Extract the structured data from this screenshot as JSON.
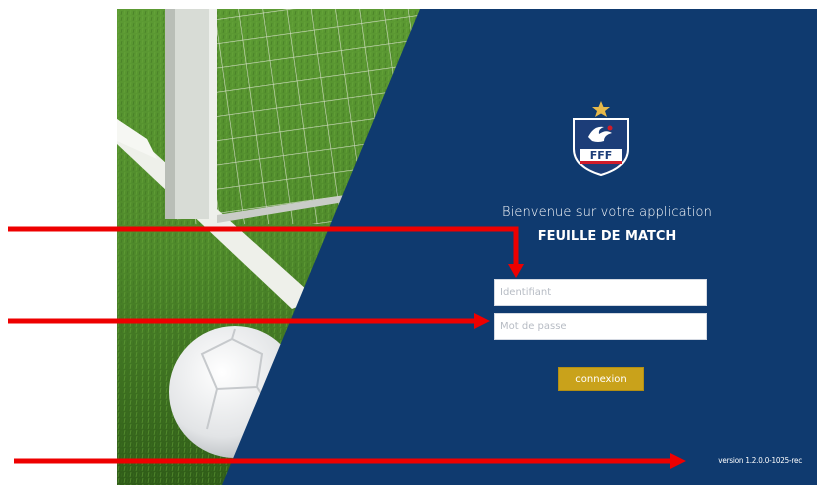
{
  "login": {
    "welcome_text": "Bienvenue sur votre application",
    "app_name": "FEUILLE DE MATCH",
    "username_placeholder": "Identifiant",
    "password_placeholder": "Mot de passe",
    "submit_label": "connexion",
    "version": "version 1.2.0.0-1025-rec"
  },
  "brand": {
    "logo_letters": "FFF"
  },
  "colors": {
    "panel_blue": "#0f3a6f",
    "button_gold": "#c9a21b",
    "annotation_red": "#ee0000",
    "grass_green": "#4f8a2b"
  },
  "annotations": [
    "arrow-to-username",
    "arrow-to-password",
    "arrow-to-version"
  ]
}
